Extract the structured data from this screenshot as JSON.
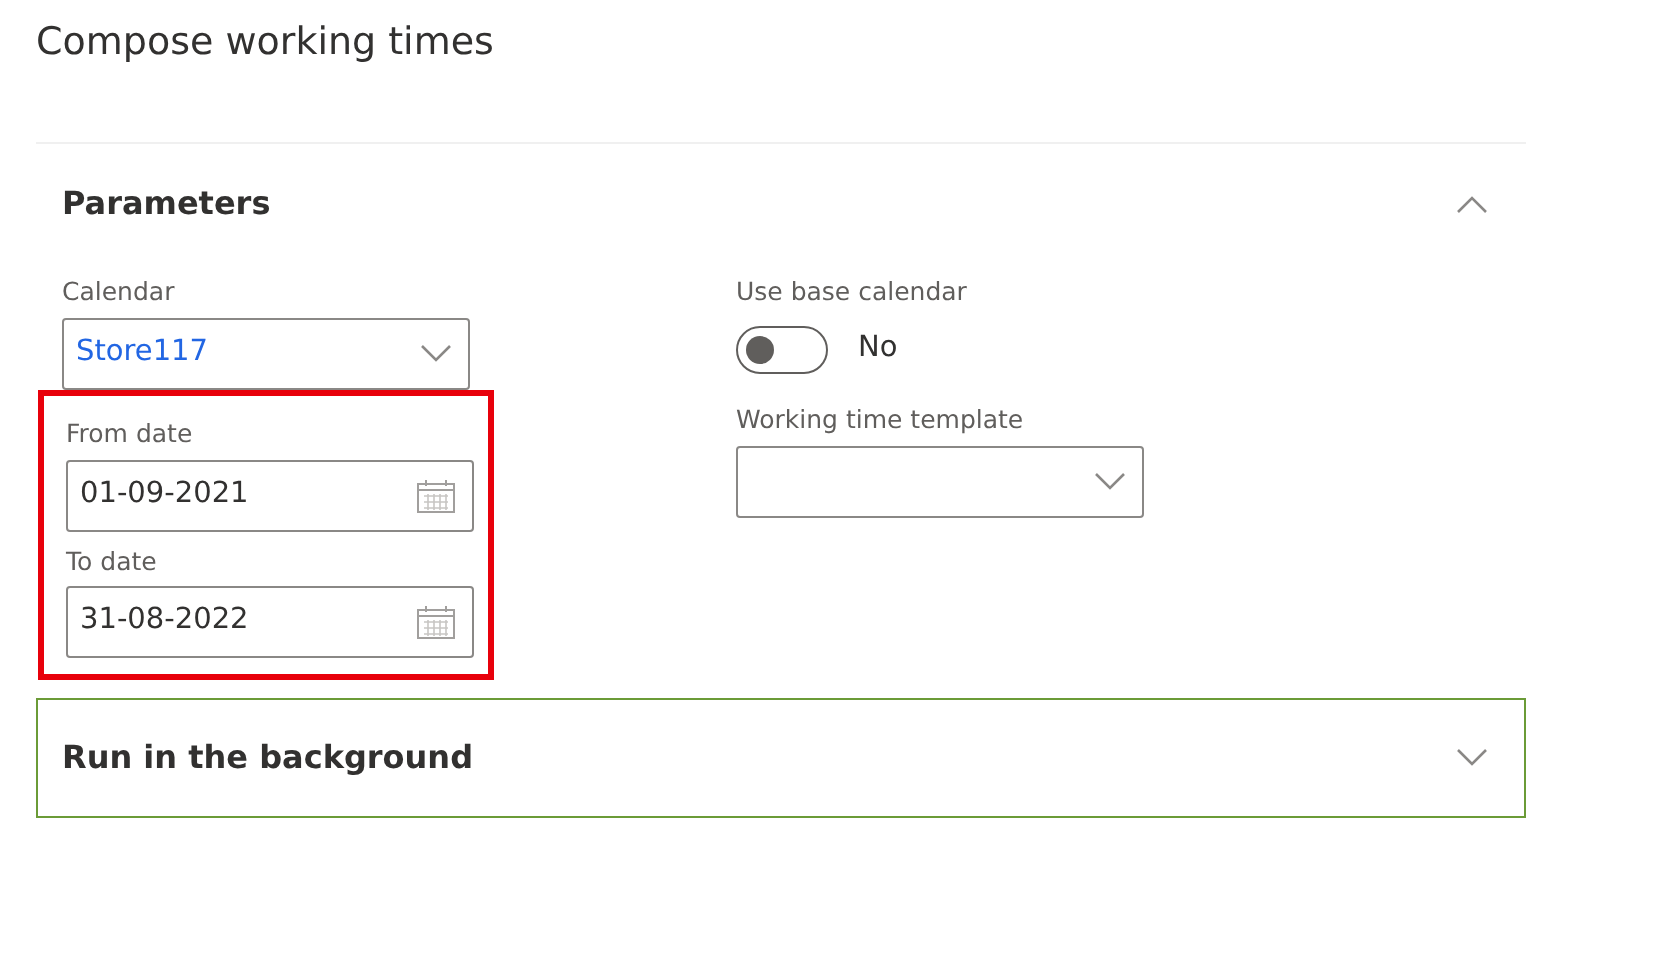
{
  "title": "Compose working times",
  "sections": [
    {
      "title": "Parameters",
      "expanded": true,
      "focused": false,
      "left_fields": [
        {
          "kind": "select",
          "label": "Calendar",
          "value": "Store117",
          "highlighted": false
        },
        {
          "kind": "date",
          "label": "From date",
          "value": "01-09-2021",
          "highlighted": true
        },
        {
          "kind": "date",
          "label": "To date",
          "value": "31-08-2022",
          "highlighted": true
        }
      ],
      "right_fields": [
        {
          "kind": "toggle",
          "label": "Use base calendar",
          "on": false,
          "value": "No"
        },
        {
          "kind": "select",
          "label": "Working time template"
        }
      ]
    },
    {
      "title": "Run in the background",
      "expanded": false,
      "focused": true
    }
  ]
}
